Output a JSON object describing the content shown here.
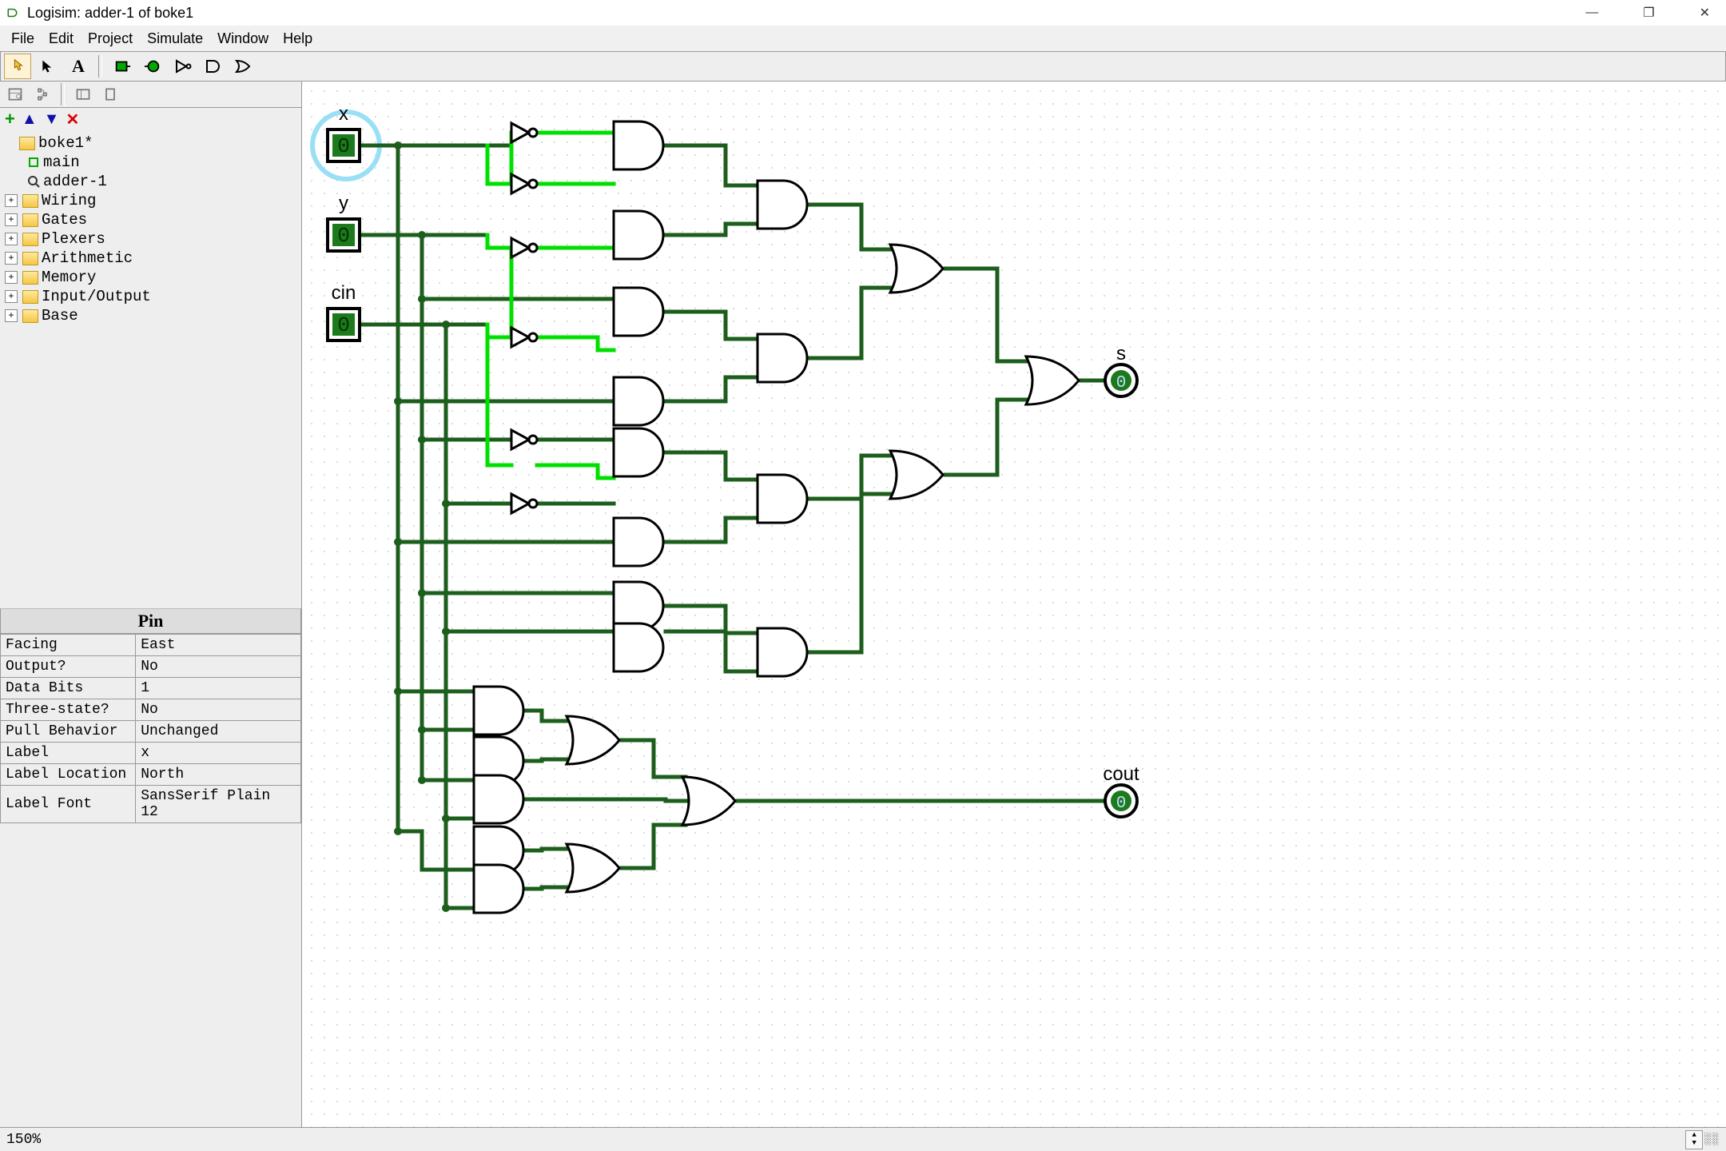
{
  "window": {
    "title": "Logisim: adder-1 of boke1"
  },
  "menu": [
    "File",
    "Edit",
    "Project",
    "Simulate",
    "Window",
    "Help"
  ],
  "tree": {
    "root": "boke1*",
    "circuits": [
      "main",
      "adder-1"
    ],
    "libs": [
      "Wiring",
      "Gates",
      "Plexers",
      "Arithmetic",
      "Memory",
      "Input/Output",
      "Base"
    ]
  },
  "properties": {
    "header": "Pin",
    "rows": [
      {
        "k": "Facing",
        "v": "East"
      },
      {
        "k": "Output?",
        "v": "No"
      },
      {
        "k": "Data Bits",
        "v": "1"
      },
      {
        "k": "Three-state?",
        "v": "No"
      },
      {
        "k": "Pull Behavior",
        "v": "Unchanged"
      },
      {
        "k": "Label",
        "v": "x"
      },
      {
        "k": "Label Location",
        "v": "North"
      },
      {
        "k": "Label Font",
        "v": "SansSerif Plain 12"
      }
    ]
  },
  "pins": {
    "x": {
      "label": "x",
      "value": "0"
    },
    "y": {
      "label": "y",
      "value": "0"
    },
    "cin": {
      "label": "cin",
      "value": "0"
    },
    "s": {
      "label": "s",
      "value": "0"
    },
    "cout": {
      "label": "cout",
      "value": "0"
    }
  },
  "status": {
    "zoom": "150%"
  },
  "colors": {
    "off": "#1c5e1c",
    "on": "#00e000",
    "selHalo": "#99dff5"
  }
}
